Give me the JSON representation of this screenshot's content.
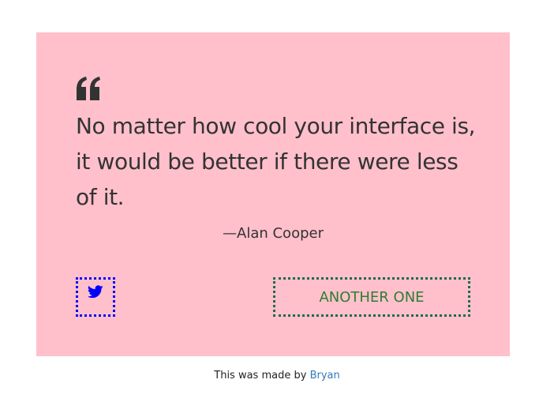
{
  "quote": {
    "text": "No matter how cool your interface is, it would be better if there were less of it.",
    "author": "—Alan Cooper",
    "quote_icon": "quote-left-icon"
  },
  "actions": {
    "tweet_icon": "twitter-icon",
    "another_label": "ANOTHER ONE"
  },
  "footer": {
    "prefix": "This was made by ",
    "link_label": "Bryan"
  },
  "colors": {
    "card_background": "#ffc0cb",
    "text": "#333333",
    "tweet_border": "#0000ff",
    "another_border": "#1b6b4a",
    "another_text": "#2e7d32",
    "link": "#337ab7"
  }
}
